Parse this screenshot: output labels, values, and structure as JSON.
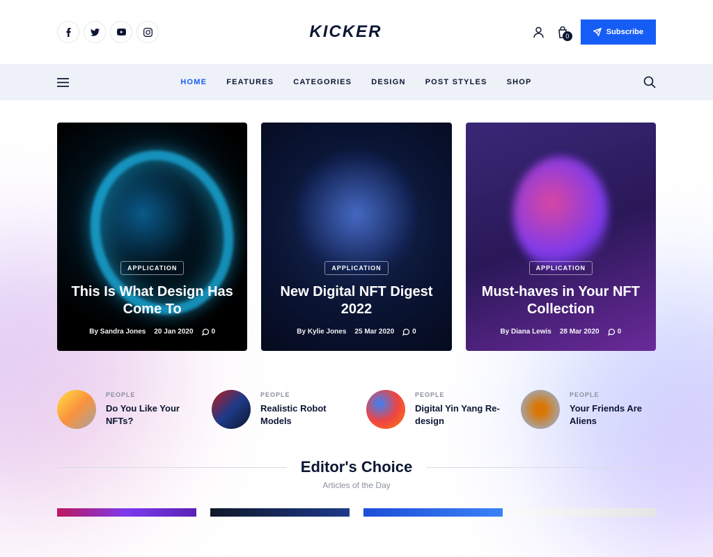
{
  "logo": "KICKER",
  "cart_count": "0",
  "subscribe": "Subscribe",
  "nav": [
    "HOME",
    "FEATURES",
    "CATEGORIES",
    "DESIGN",
    "POST STYLES",
    "SHOP"
  ],
  "hero": [
    {
      "tag": "APPLICATION",
      "title": "This Is What Design Has Come To",
      "author": "By Sandra Jones",
      "date": "20 Jan 2020",
      "comments": "0"
    },
    {
      "tag": "APPLICATION",
      "title": "New Digital NFT Digest 2022",
      "author": "By Kylie Jones",
      "date": "25 Mar 2020",
      "comments": "0"
    },
    {
      "tag": "APPLICATION",
      "title": "Must-haves in Your NFT Collection",
      "author": "By Diana Lewis",
      "date": "28 Mar 2020",
      "comments": "0"
    }
  ],
  "people": [
    {
      "cat": "PEOPLE",
      "title": "Do You Like Your NFTs?"
    },
    {
      "cat": "PEOPLE",
      "title": "Realistic Robot Models"
    },
    {
      "cat": "PEOPLE",
      "title": "Digital Yin Yang Re-design"
    },
    {
      "cat": "PEOPLE",
      "title": "Your Friends Are Aliens"
    }
  ],
  "editor": {
    "title": "Editor's Choice",
    "sub": "Articles of the Day"
  }
}
